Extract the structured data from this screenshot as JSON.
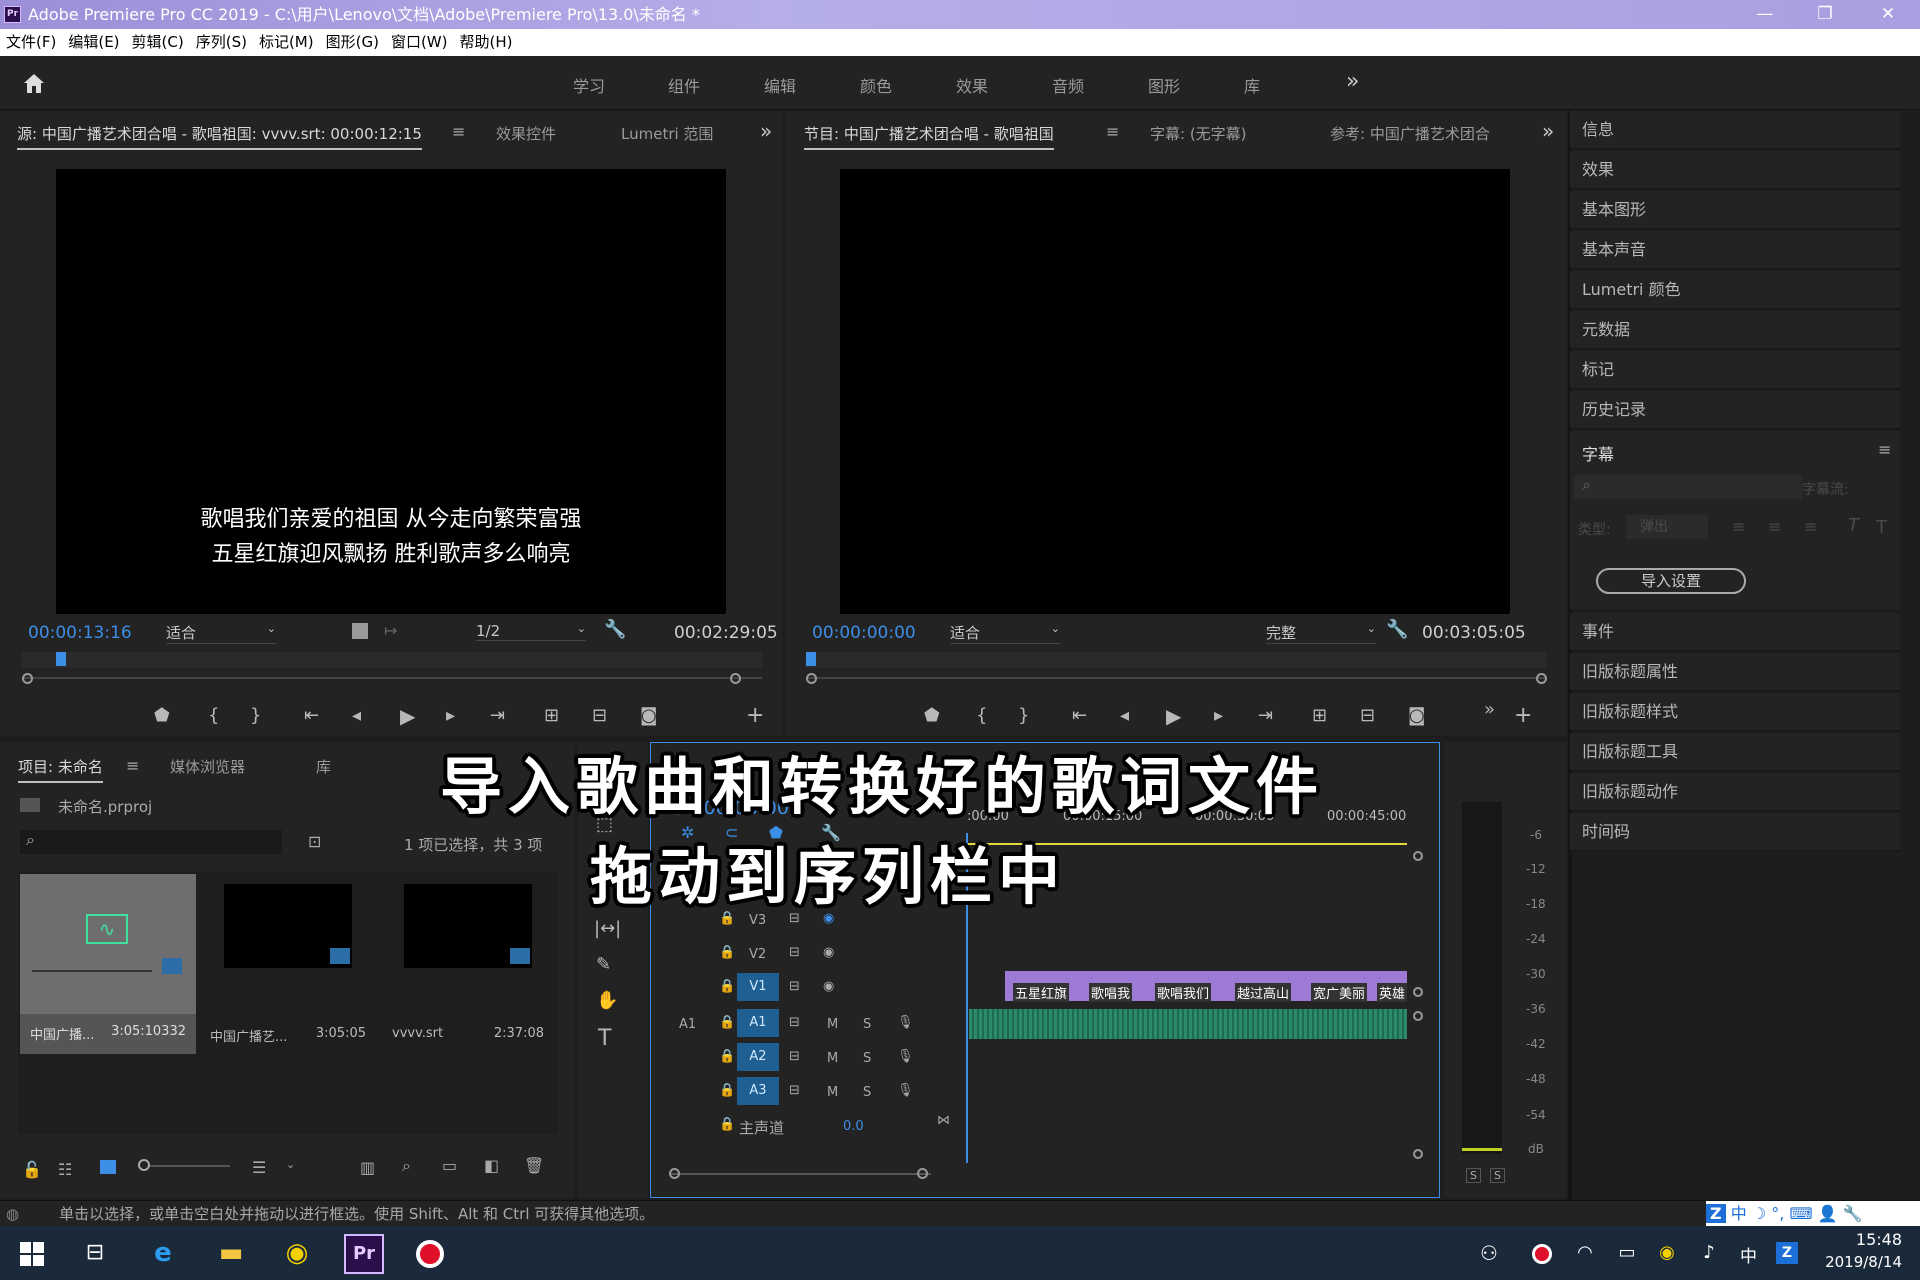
{
  "window": {
    "title": "Adobe Premiere Pro CC 2019 - C:\\用户\\Lenovo\\文档\\Adobe\\Premiere Pro\\13.0\\未命名 *",
    "pr_badge": "Pr",
    "min": "—",
    "max": "❐",
    "close": "✕"
  },
  "menu": [
    "文件(F)",
    "编辑(E)",
    "剪辑(C)",
    "序列(S)",
    "标记(M)",
    "图形(G)",
    "窗口(W)",
    "帮助(H)"
  ],
  "workspaces": [
    "学习",
    "组件",
    "编辑",
    "颜色",
    "效果",
    "音频",
    "图形",
    "库"
  ],
  "workspaces_more": "»",
  "source": {
    "tab": "源: 中国广播艺术团合唱 - 歌唱祖国: vvvv.srt: 00:00:12:15",
    "tab2": "效果控件",
    "tab3": "Lumetri 范围",
    "subtitle1": "歌唱我们亲爱的祖国  从今走向繁荣富强",
    "subtitle2": "五星红旗迎风飘扬  胜利歌声多么响亮",
    "timecode": "00:00:13:16",
    "fit": "适合",
    "res": "1/2",
    "duration": "00:02:29:05"
  },
  "program": {
    "tab": "节目: 中国广播艺术团合唱 - 歌唱祖国",
    "tab2": "字幕: (无字幕)",
    "tab3": "参考: 中国广播艺术团合",
    "timecode": "00:00:00:00",
    "fit": "适合",
    "quality": "完整",
    "duration": "00:03:05:05"
  },
  "right_panels": [
    "信息",
    "效果",
    "基本图形",
    "基本声音",
    "Lumetri 颜色",
    "元数据",
    "标记",
    "历史记录"
  ],
  "captions": {
    "title": "字幕",
    "type_label": "类型:",
    "type_value": "弹出",
    "stream_label": "字幕流:",
    "import_btn": "导入设置"
  },
  "right_panels2": [
    "事件",
    "旧版标题属性",
    "旧版标题样式",
    "旧版标题工具",
    "旧版标题动作",
    "时间码"
  ],
  "project": {
    "tab": "项目: 未命名",
    "tab2": "媒体浏览器",
    "tab3": "库",
    "file": "未命名.prproj",
    "selection": "1 项已选择，共 3 项",
    "items": [
      {
        "name": "中国广播...",
        "dur": "3:05:10332"
      },
      {
        "name": "中国广播艺...",
        "dur": "3:05:05"
      },
      {
        "name": "vvvv.srt",
        "dur": "2:37:08"
      }
    ]
  },
  "timeline": {
    "timecode": "00:00:00:00",
    "ruler": [
      ":00:00",
      "00:00:15:00",
      "00:00:30:00",
      "00:00:45:00"
    ],
    "tracks": [
      "V3",
      "V2",
      "V1",
      "A1",
      "A2",
      "A3"
    ],
    "master": "主声道",
    "master_val": "0.0",
    "src_a1": "A1",
    "m": "M",
    "s": "S",
    "captions": [
      "五星红旗",
      "歌唱我",
      "歌唱我们",
      "越过高山",
      "宽广美丽",
      "英雄"
    ]
  },
  "meter": {
    "labels": [
      "-6",
      "-12",
      "-18",
      "-24",
      "-30",
      "-36",
      "-42",
      "-48",
      "-54",
      "dB"
    ],
    "s": "S"
  },
  "overlay": {
    "line1": "导入歌曲和转换好的歌词文件",
    "line2": "拖动到序列栏中"
  },
  "status": "单击以选择，或单击空白处并拖动以进行框选。使用 Shift、Alt 和 Ctrl 可获得其他选项。",
  "ime": [
    "中",
    "☽",
    "°,",
    "⌨",
    "👤",
    "🔧"
  ],
  "taskbar": {
    "time": "15:48",
    "date": "2019/8/14",
    "lang": "中"
  }
}
